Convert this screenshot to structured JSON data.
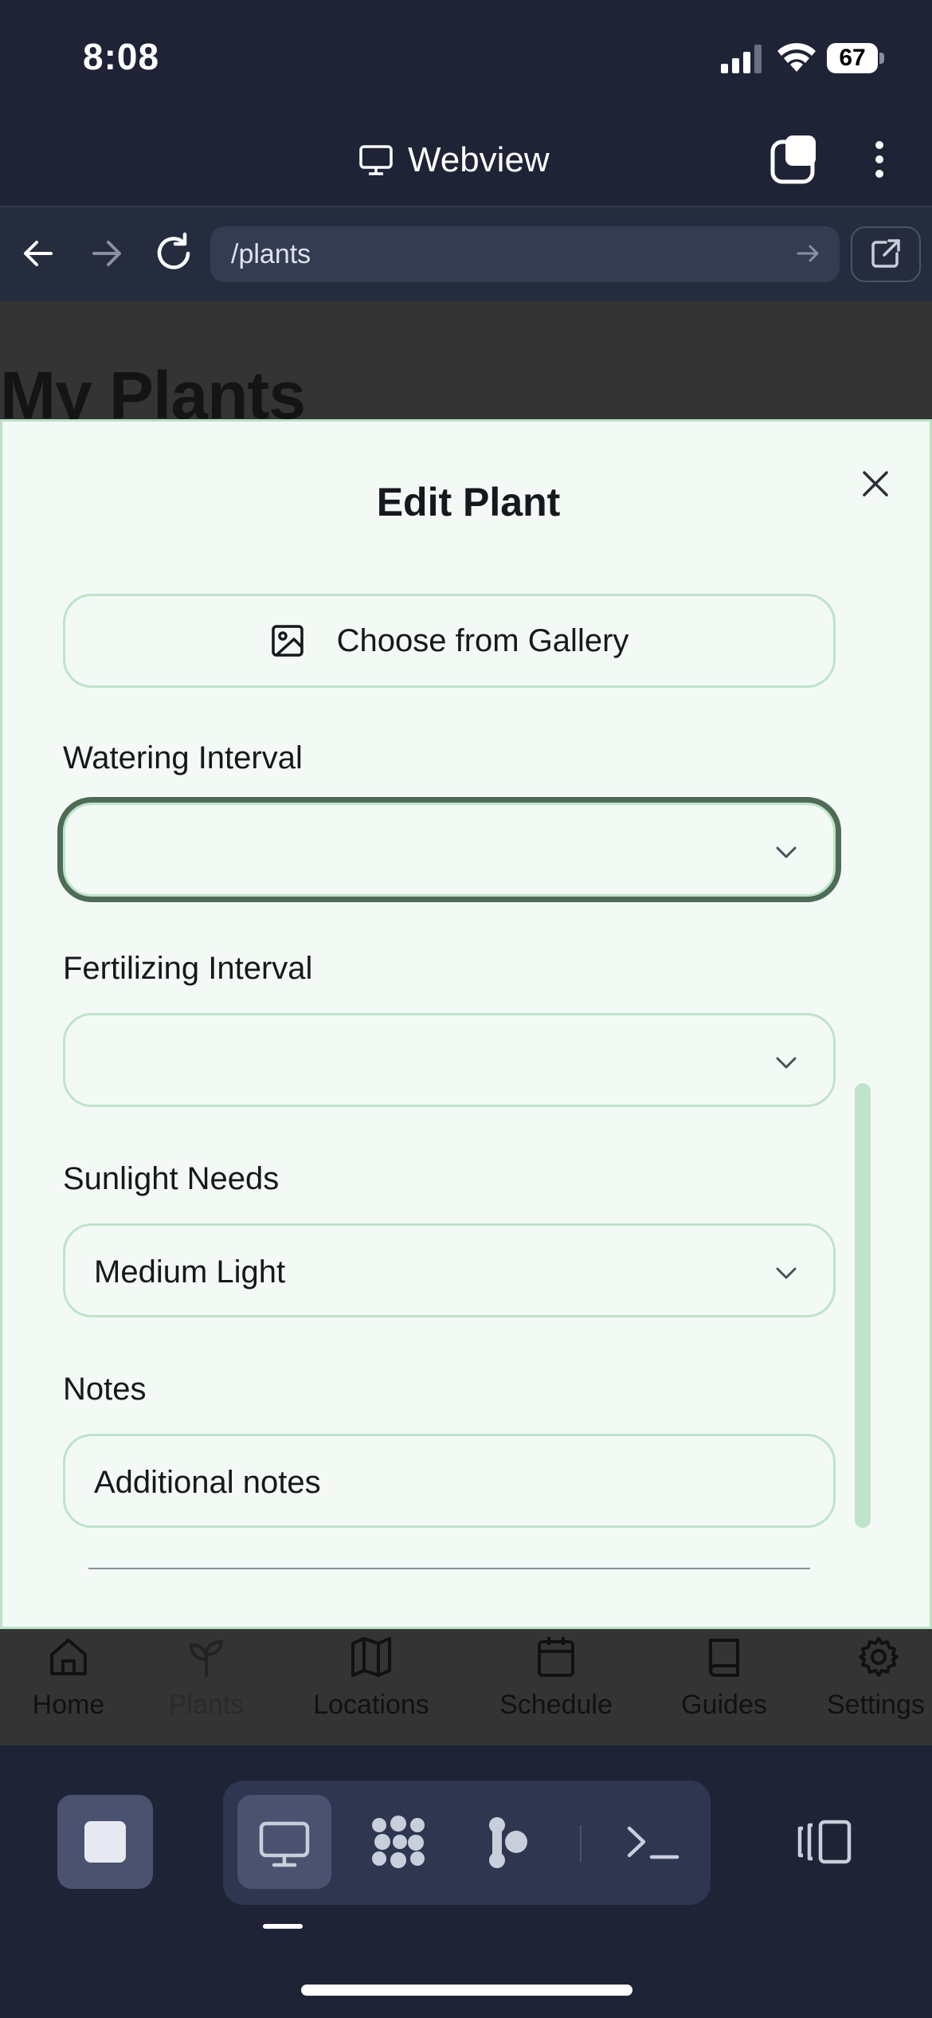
{
  "status_bar": {
    "time": "8:08",
    "battery": "67"
  },
  "header": {
    "title": "Webview"
  },
  "browser": {
    "url": "/plants"
  },
  "page": {
    "title": "My Plants"
  },
  "modal": {
    "title": "Edit Plant",
    "gallery_label": "Choose from Gallery",
    "watering": {
      "label": "Watering Interval",
      "value": ""
    },
    "fertilizing": {
      "label": "Fertilizing Interval",
      "value": ""
    },
    "sunlight": {
      "label": "Sunlight Needs",
      "value": "Medium Light"
    },
    "notes": {
      "label": "Notes",
      "placeholder": "Additional notes"
    }
  },
  "app_tabs": [
    {
      "label": "Home",
      "icon": "home-icon"
    },
    {
      "label": "Plants",
      "icon": "sprout-icon"
    },
    {
      "label": "Locations",
      "icon": "map-icon"
    },
    {
      "label": "Schedule",
      "icon": "calendar-icon"
    },
    {
      "label": "Guides",
      "icon": "book-icon"
    },
    {
      "label": "Settings",
      "icon": "gear-icon"
    }
  ],
  "colors": {
    "chrome_bg": "#1e2436",
    "modal_bg": "#f3faf5",
    "modal_border": "#bfe3cb",
    "focus_ring": "#4e6b56"
  }
}
